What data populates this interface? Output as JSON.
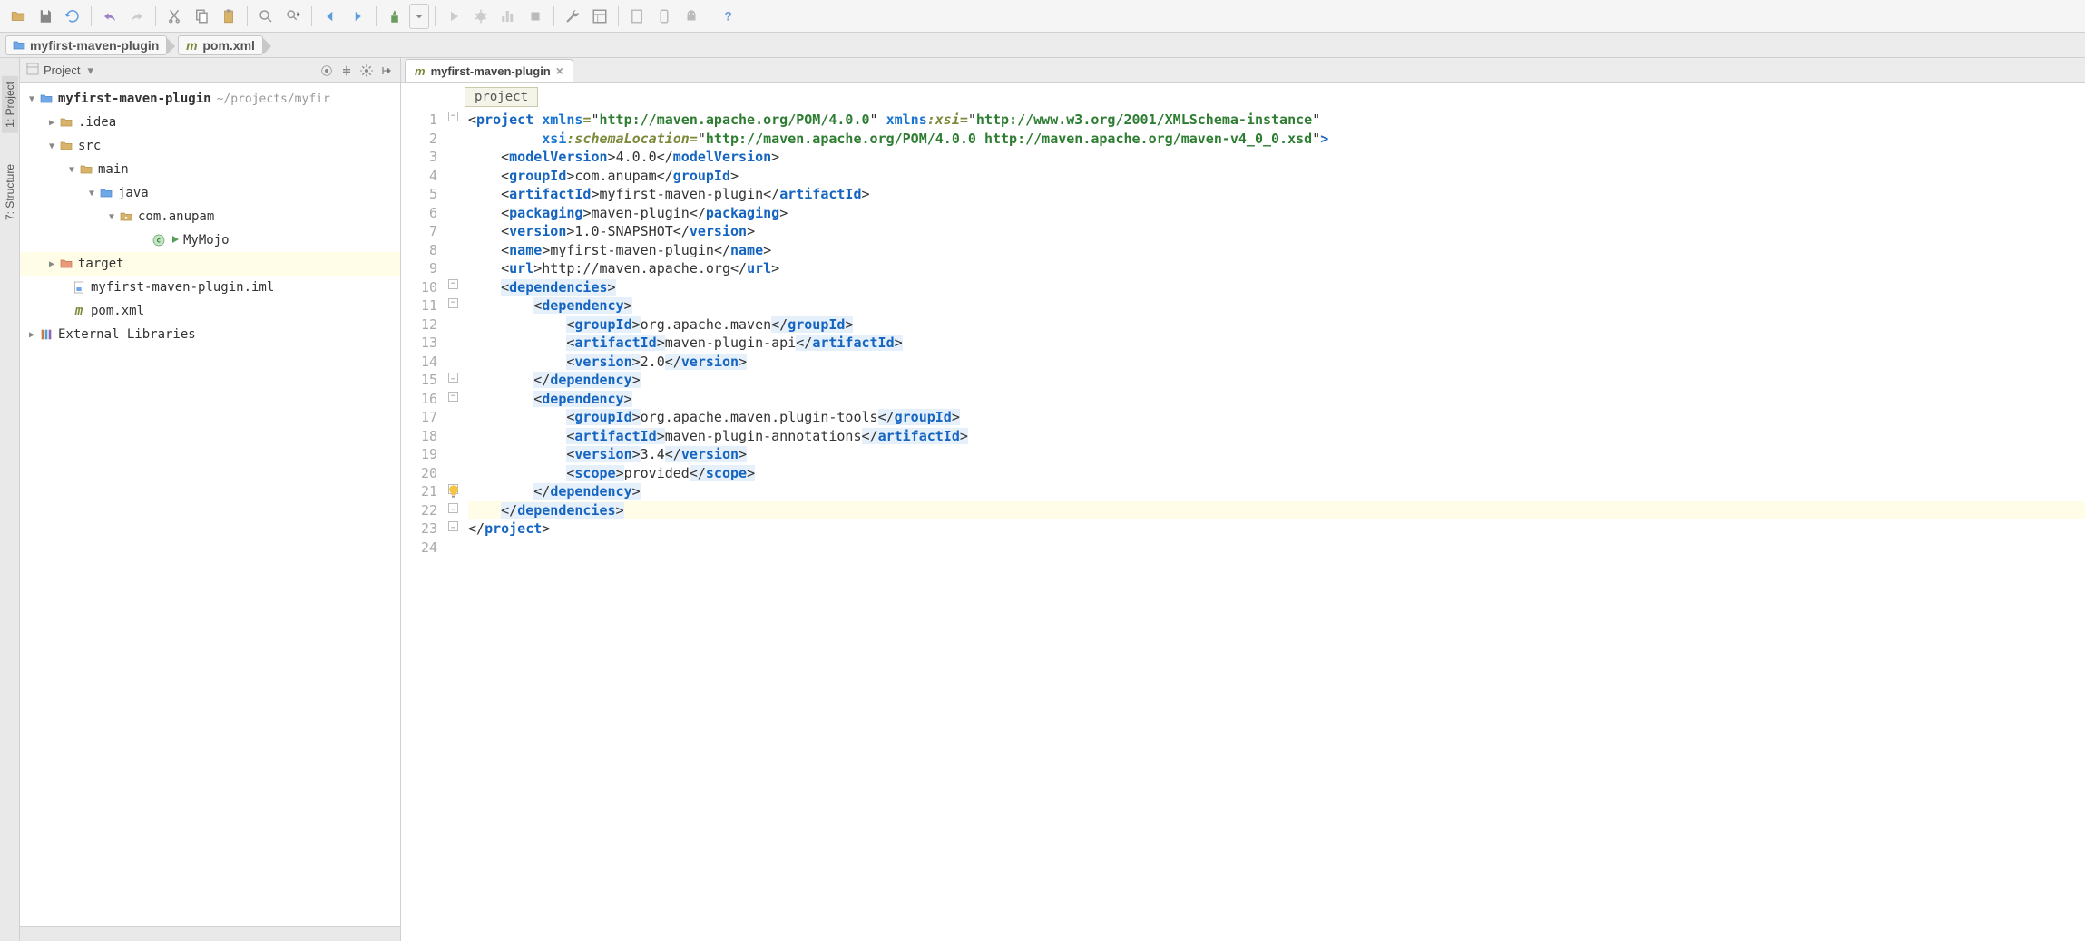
{
  "toolbar_icons": [
    "open-icon",
    "save-all-icon",
    "refresh-icon",
    "",
    "undo-icon",
    "redo-icon",
    "",
    "cut-icon",
    "copy-icon",
    "paste-icon",
    "",
    "zoom-in-icon",
    "zoom-out-icon",
    "",
    "back-icon",
    "forward-icon",
    "",
    "sort-icon",
    "dropdown-icon",
    "",
    "run-icon",
    "debug-icon",
    "coverage-icon",
    "stop-icon",
    "",
    "tools-icon",
    "structure-icon",
    "",
    "device1-icon",
    "device2-icon",
    "android-icon",
    "",
    "help-icon"
  ],
  "breadcrumb": {
    "project": "myfirst-maven-plugin",
    "file": "pom.xml"
  },
  "left_tabs": {
    "project": "1: Project",
    "structure": "7: Structure"
  },
  "panel": {
    "title": "Project"
  },
  "tree": {
    "root": "myfirst-maven-plugin",
    "root_path": "~/projects/myfir",
    "idea": ".idea",
    "src": "src",
    "main": "main",
    "java": "java",
    "pkg": "com.anupam",
    "cls": "MyMojo",
    "target": "target",
    "iml": "myfirst-maven-plugin.iml",
    "pom": "pom.xml",
    "ext": "External Libraries"
  },
  "editor": {
    "tab": "myfirst-maven-plugin",
    "crumb": "project"
  },
  "line_numbers": [
    "1",
    "2",
    "3",
    "4",
    "5",
    "6",
    "7",
    "8",
    "9",
    "10",
    "11",
    "12",
    "13",
    "14",
    "15",
    "16",
    "17",
    "18",
    "19",
    "20",
    "21",
    "22",
    "23",
    "24"
  ],
  "xml": {
    "project_open_a": "project",
    "xmlns_attr": "xmlns",
    "xmlns_val": "http://maven.apache.org/POM/4.0.0",
    "xmlnsxsi_attr": "xmlns:xsi",
    "xmlnsxsi_val": "http://www.w3.org/2001/XMLSchema-instance",
    "xsisl_attr": "xsi:schemaLocation",
    "xsisl_val": "http://maven.apache.org/POM/4.0.0 http://maven.apache.org/maven-v4_0_0.xsd",
    "modelVersion_tag": "modelVersion",
    "modelVersion_val": "4.0.0",
    "groupId_tag": "groupId",
    "groupId_val": "com.anupam",
    "artifactId_tag": "artifactId",
    "artifactId_val": "myfirst-maven-plugin",
    "packaging_tag": "packaging",
    "packaging_val": "maven-plugin",
    "version_tag": "version",
    "version_val": "1.0-SNAPSHOT",
    "name_tag": "name",
    "name_val": "myfirst-maven-plugin",
    "url_tag": "url",
    "url_val": "http://maven.apache.org",
    "dependencies_tag": "dependencies",
    "dependency_tag": "dependency",
    "dep1_group": "org.apache.maven",
    "dep1_artifact": "maven-plugin-api",
    "dep1_version": "2.0",
    "dep2_group": "org.apache.maven.plugin-tools",
    "dep2_artifact": "maven-plugin-annotations",
    "dep2_version": "3.4",
    "scope_tag": "scope",
    "scope_val": "provided"
  }
}
